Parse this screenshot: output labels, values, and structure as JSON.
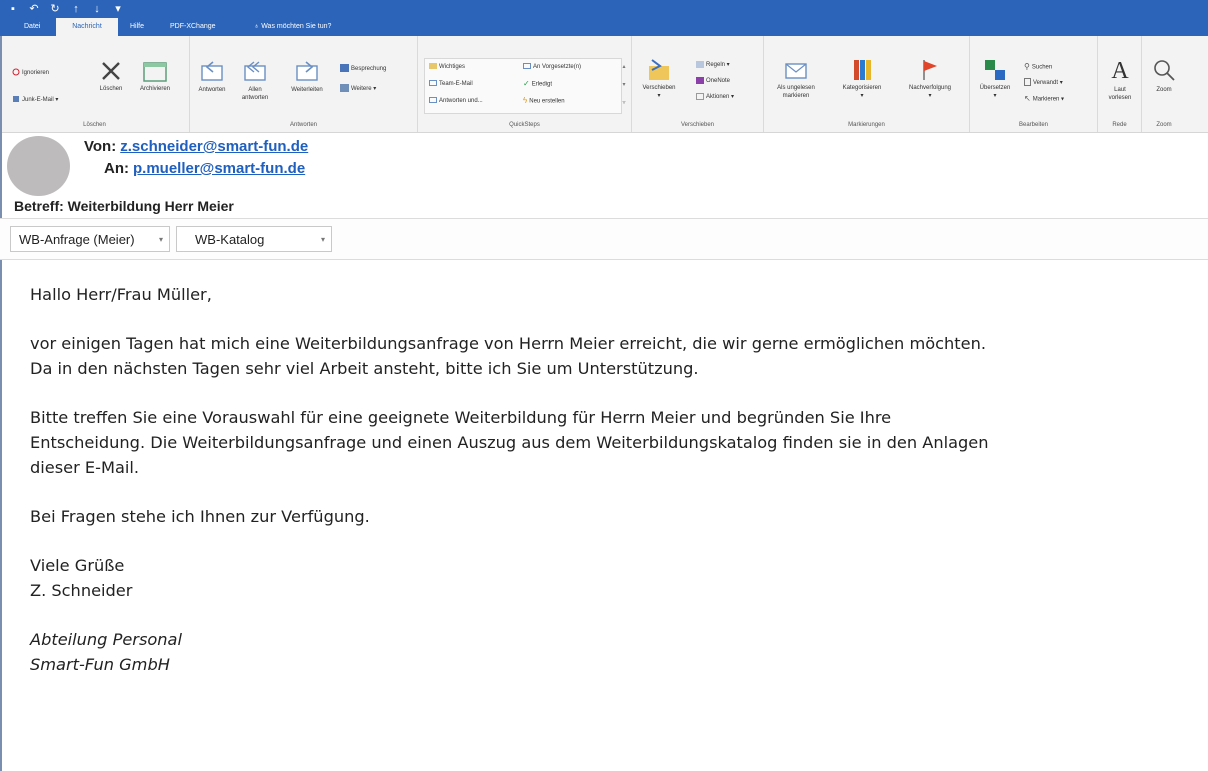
{
  "quick_access": [
    "save-icon",
    "undo-icon",
    "redo-icon",
    "up-icon",
    "down-icon",
    "more-icon"
  ],
  "tabs": [
    {
      "label": "Datei",
      "active": false
    },
    {
      "label": "Nachricht",
      "active": true
    },
    {
      "label": "Hilfe",
      "active": false
    },
    {
      "label": "PDF-XChange",
      "active": false
    },
    {
      "label": "Was möchten Sie tun?",
      "active": false,
      "icon": "lightbulb-icon"
    }
  ],
  "ribbon": {
    "loeschen": {
      "label": "Löschen",
      "ignore": "Ignorieren",
      "junk": "Junk-E-Mail",
      "delete": "Löschen",
      "archive": "Archivieren"
    },
    "antworten": {
      "label": "Antworten",
      "reply": "Antworten",
      "reply_all_1": "Allen",
      "reply_all_2": "antworten",
      "forward": "Weiterleiten",
      "meeting": "Besprechung",
      "more": "Weitere"
    },
    "quicksteps": {
      "label": "QuickSteps",
      "items": [
        "Wichtiges",
        "Team-E-Mail",
        "Antworten und...",
        "An Vorgesetzte(n)",
        "Erledigt",
        "Neu erstellen"
      ]
    },
    "verschieben": {
      "label": "Verschieben",
      "move": "Verschieben",
      "rules": "Regeln",
      "onenote": "OneNote",
      "actions": "Aktionen"
    },
    "markierungen": {
      "label": "Markierungen",
      "unread_1": "Als ungelesen",
      "unread_2": "markieren",
      "categorize": "Kategorisieren",
      "followup": "Nachverfolgung"
    },
    "bearbeiten": {
      "label": "Bearbeiten",
      "translate": "Übersetzen",
      "search": "Suchen",
      "related": "Verwandt",
      "select": "Markieren"
    },
    "rede": {
      "label": "Rede",
      "read_1": "Laut",
      "read_2": "vorlesen"
    },
    "zoom": {
      "label": "Zoom",
      "zoom": "Zoom"
    }
  },
  "header": {
    "from_label": "Von:",
    "from": "z.schneider@smart-fun.de",
    "to_label": "An:",
    "to": "p.mueller@smart-fun.de",
    "subject": "Betreff: Weiterbildung Herr Meier"
  },
  "attachments": [
    {
      "name": "WB-Anfrage (Meier)"
    },
    {
      "name": "WB-Katalog"
    }
  ],
  "body": {
    "greeting": "Hallo Herr/Frau Müller,",
    "p1_l1": "vor einigen Tagen hat mich eine Weiterbildungsanfrage von Herrn Meier erreicht, die wir gerne ermöglichen möchten.",
    "p1_l2": "Da in den nächsten Tagen sehr viel Arbeit ansteht, bitte ich Sie um Unterstützung.",
    "p2_l1": "Bitte treffen Sie eine Vorauswahl für eine geeignete Weiterbildung für Herrn Meier und begründen Sie Ihre",
    "p2_l2": "Entscheidung. Die Weiterbildungsanfrage und einen Auszug aus dem Weiterbildungskatalog finden sie in den Anlagen",
    "p2_l3": "dieser E-Mail.",
    "p3": "Bei Fragen stehe ich Ihnen zur Verfügung.",
    "closing": "Viele Grüße",
    "name": "Z. Schneider",
    "dept": "Abteilung Personal",
    "company": "Smart-Fun GmbH"
  },
  "colors": {
    "title_bar": "#2b64b8",
    "link": "#1f5fbf",
    "ribbon_bg": "#f3f3f3"
  }
}
